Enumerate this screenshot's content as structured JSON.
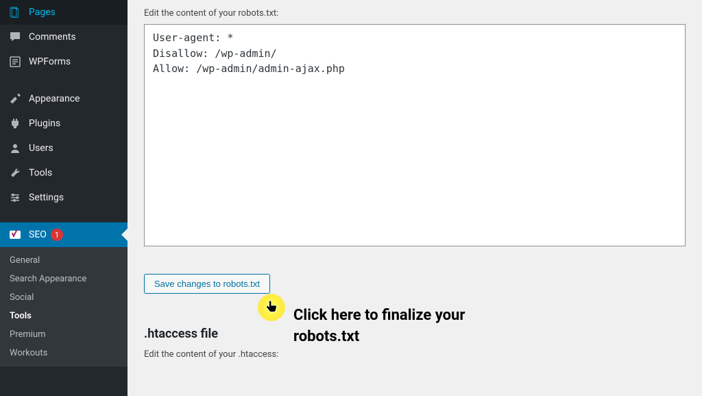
{
  "sidebar": {
    "items": [
      {
        "label": "Pages",
        "icon": "pages"
      },
      {
        "label": "Comments",
        "icon": "comments"
      },
      {
        "label": "WPForms",
        "icon": "wpforms"
      }
    ],
    "items2": [
      {
        "label": "Appearance",
        "icon": "appearance"
      },
      {
        "label": "Plugins",
        "icon": "plugins"
      },
      {
        "label": "Users",
        "icon": "users"
      },
      {
        "label": "Tools",
        "icon": "tools"
      },
      {
        "label": "Settings",
        "icon": "settings"
      }
    ],
    "seo": {
      "label": "SEO",
      "badge": "1"
    },
    "submenu": [
      {
        "label": "General"
      },
      {
        "label": "Search Appearance"
      },
      {
        "label": "Social"
      },
      {
        "label": "Tools",
        "current": true
      },
      {
        "label": "Premium"
      },
      {
        "label": "Workouts"
      }
    ]
  },
  "main": {
    "robots_label": "Edit the content of your robots.txt:",
    "robots_content": "User-agent: *\nDisallow: /wp-admin/\nAllow: /wp-admin/admin-ajax.php",
    "save_robots": "Save changes to robots.txt",
    "htaccess_title": ".htaccess file",
    "htaccess_label": "Edit the content of your .htaccess:"
  },
  "annotation": "Click here to finalize your robots.txt"
}
